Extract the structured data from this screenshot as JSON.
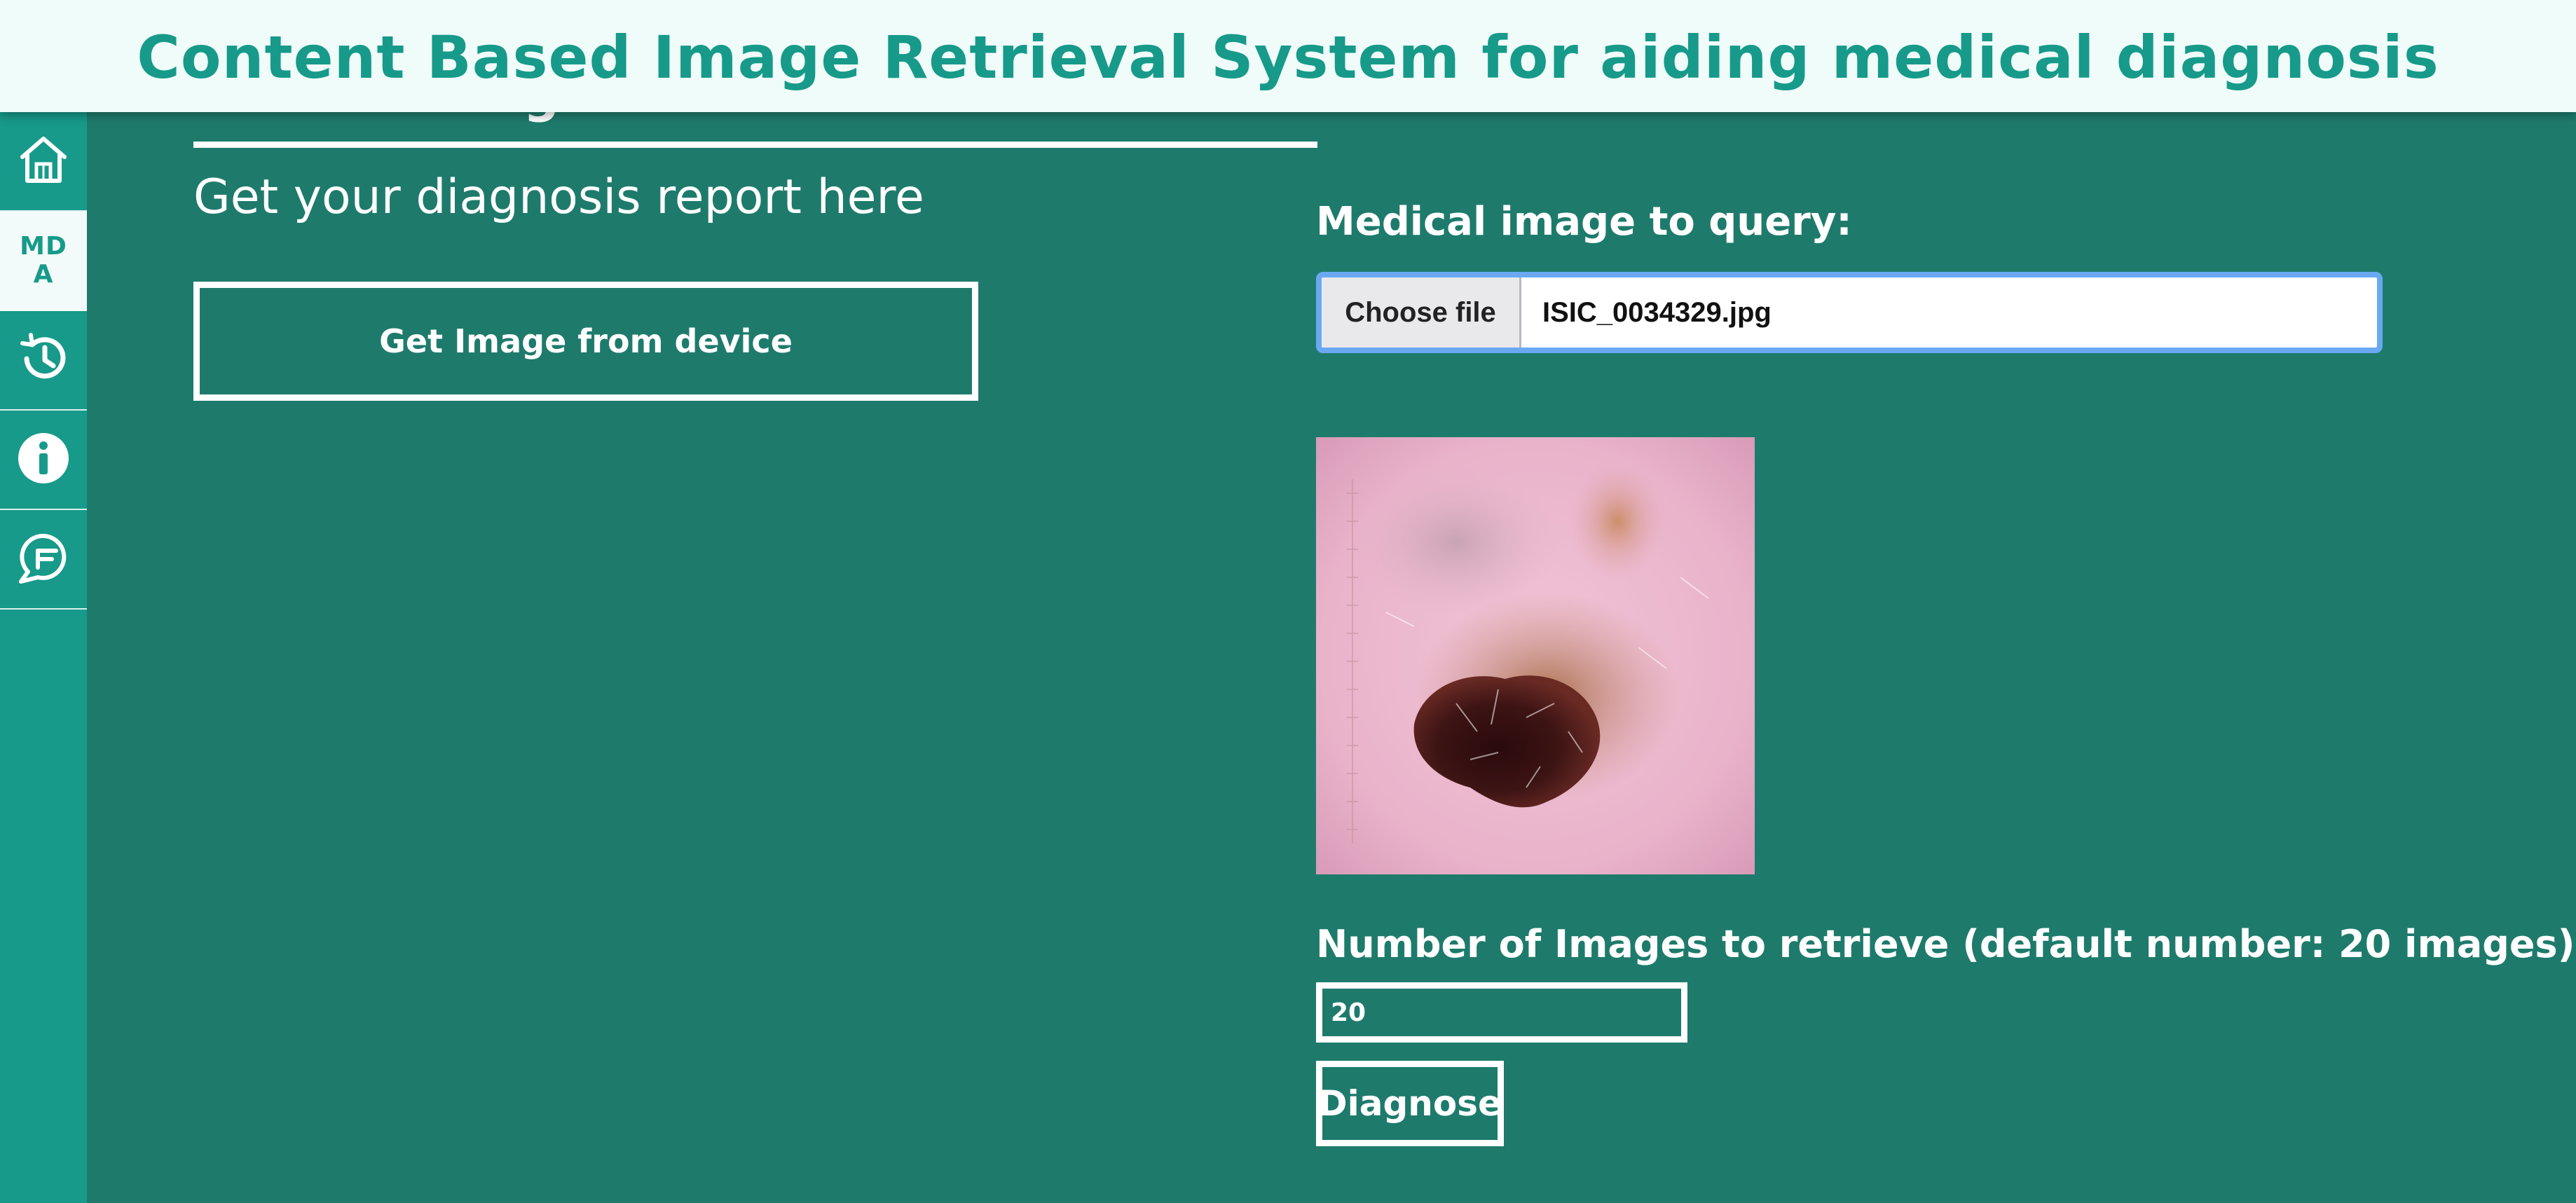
{
  "header": {
    "title": "Content Based Image Retrieval System for aiding medical diagnosis"
  },
  "sidebar": {
    "items": [
      {
        "icon": "home-icon"
      },
      {
        "label": "MD\nA",
        "icon": "mda-logo",
        "active": true
      },
      {
        "icon": "history-icon"
      },
      {
        "icon": "info-icon"
      },
      {
        "icon": "feedback-icon"
      }
    ]
  },
  "main": {
    "section_title": "Medical Diagnosis Assistant",
    "subtitle": "Get your diagnosis report here",
    "get_image_button": "Get Image from device"
  },
  "query": {
    "label": "Medical image to query:",
    "choose_file_label": "Choose file",
    "file_name": "ISIC_0034329.jpg"
  },
  "retrieve": {
    "label": "Number of Images to retrieve (default number: 20 images):",
    "value": "20",
    "diagnose_button": "Diagnose"
  },
  "colors": {
    "background": "#1e7b6c",
    "sidebar": "#179a8a",
    "banner": "#effcf9",
    "accent": "#179a8a"
  }
}
